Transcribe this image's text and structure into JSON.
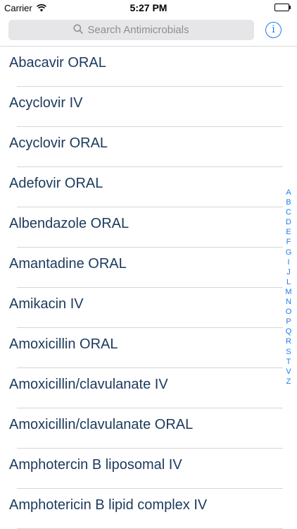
{
  "status_bar": {
    "carrier": "Carrier",
    "time": "5:27 PM",
    "battery_level": 1.0,
    "battery_color": "#4cd964"
  },
  "search": {
    "placeholder": "Search Antimicrobials",
    "icon": "search-icon"
  },
  "info_button": {
    "glyph": "i",
    "icon": "info-icon",
    "color": "#1a7cf5"
  },
  "list": {
    "items": [
      "Abacavir ORAL",
      "Acyclovir IV",
      "Acyclovir ORAL",
      "Adefovir ORAL",
      "Albendazole ORAL",
      "Amantadine ORAL",
      "Amikacin IV",
      "Amoxicillin ORAL",
      "Amoxicillin/clavulanate IV",
      "Amoxicillin/clavulanate ORAL",
      "Amphotercin B liposomal IV",
      "Amphotericin B lipid complex IV"
    ]
  },
  "index": {
    "letters": [
      "A",
      "B",
      "C",
      "D",
      "E",
      "F",
      "G",
      "I",
      "J",
      "L",
      "M",
      "N",
      "O",
      "P",
      "Q",
      "R",
      "S",
      "T",
      "V",
      "Z"
    ]
  }
}
